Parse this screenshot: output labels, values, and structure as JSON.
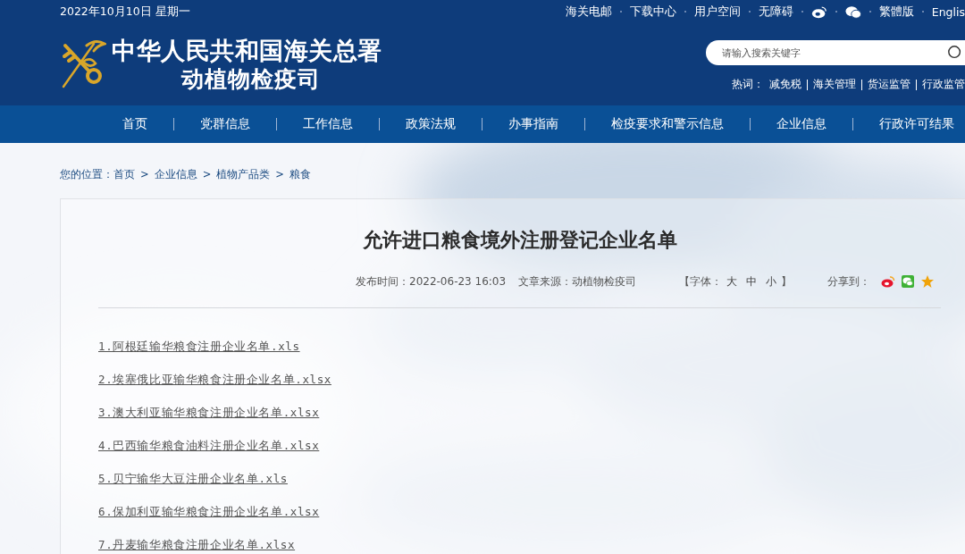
{
  "header": {
    "date": "2022年10月10日 星期一",
    "top_links": [
      "海关电邮",
      "下载中心",
      "用户空间",
      "无障碍"
    ],
    "top_links_after_icons": [
      "繁體版",
      "Englis"
    ],
    "site_title": "中华人民共和国海关总署",
    "site_subtitle": "动植物检疫司",
    "search": {
      "placeholder": "请输入搜索关键字"
    },
    "hot_words": {
      "label": "热词：",
      "words": [
        "减免税",
        "海关管理",
        "货运监管",
        "行政监管"
      ]
    }
  },
  "nav": [
    {
      "label": "首页"
    },
    {
      "label": "党群信息"
    },
    {
      "label": "工作信息"
    },
    {
      "label": "政策法规"
    },
    {
      "label": "办事指南"
    },
    {
      "label": "检疫要求和警示信息"
    },
    {
      "label": "企业信息"
    },
    {
      "label": "行政许可结果"
    }
  ],
  "breadcrumb": {
    "label": "您的位置：",
    "separator": ">",
    "items": [
      "首页",
      "企业信息",
      "植物产品类",
      "粮食"
    ]
  },
  "article": {
    "title": "允许进口粮食境外注册登记企业名单",
    "published": "发布时间：2022-06-23 16:03",
    "source": "文章来源：动植物检疫司",
    "font_size": {
      "label": "【字体：",
      "options": [
        "大",
        "中",
        "小"
      ],
      "close": "】"
    },
    "share_label": "分享到：",
    "attachments": [
      "1.阿根廷输华粮食注册企业名单.xls",
      "2.埃塞俄比亚输华粮食注册企业名单.xlsx",
      "3.澳大利亚输华粮食注册企业名单.xlsx",
      "4.巴西输华粮食油料注册企业名单.xlsx",
      "5.贝宁输华大豆注册企业名单.xls",
      "6.保加利亚输华粮食注册企业名单.xlsx",
      "7.丹麦输华粮食注册企业名单.xlsx"
    ]
  }
}
